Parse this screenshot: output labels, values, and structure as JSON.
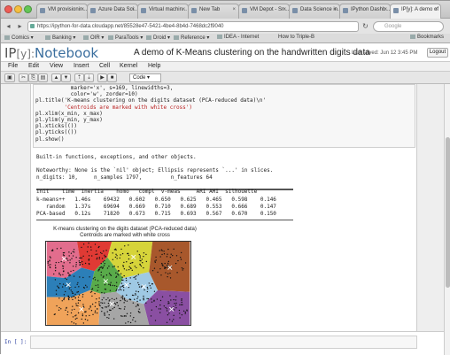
{
  "browser": {
    "tabs": [
      {
        "label": "VM provisionin...",
        "active": false
      },
      {
        "label": "Azure Data Sci...",
        "active": false
      },
      {
        "label": "Virtual machin...",
        "active": false
      },
      {
        "label": "New Tab",
        "active": false
      },
      {
        "label": "VM Depot - Sn...",
        "active": false
      },
      {
        "label": "Data Science in...",
        "active": false
      },
      {
        "label": "IPython Dashb...",
        "active": false
      },
      {
        "label": "IP[y]: A demo of K...",
        "active": true
      }
    ],
    "url": "https://ipython-for-data.cloudapp.net/85528e47-5421-4be4-8b4d-7468dc2f9040",
    "search_placeholder": "Google",
    "bookmarks": [
      "Comics",
      "Banking",
      "OIR",
      "ParaTools",
      "Droid",
      "Reference",
      "IDEA - Internet",
      "How to Triple-B",
      "Bookmarks"
    ]
  },
  "notebook": {
    "logo_ip": "IP",
    "logo_y": "[y]:",
    "logo_notebook": "Notebook",
    "title": "A demo of K-Means clustering on the handwritten digits data",
    "last_saved": "Last saved: Jun 12 3:45 PM",
    "logout_label": "Logout",
    "menu": [
      "File",
      "Edit",
      "View",
      "Insert",
      "Cell",
      "Kernel",
      "Help"
    ],
    "cell_type": "Code",
    "code_lines": [
      "           marker='x', s=169, linewidths=3,",
      "           color='w', zorder=10)",
      "pl.title('K-means clustering on the digits dataset (PCA-reduced data)\\n'",
      "         'Centroids are marked with white cross')",
      "pl.xlim(x_min, x_max)",
      "pl.ylim(y_min, y_max)",
      "pl.xticks(())",
      "pl.yticks(())",
      "pl.show()"
    ],
    "output_lines": [
      "Built-in functions, exceptions, and other objects.",
      "",
      "Noteworthy: None is the `nil' object; Ellipsis represents `...' in slices.",
      "n_digits: 10,     n_samples 1797,         n_features 64"
    ],
    "table_header": "init    time  inertia    homo   compl  v-meas     ARI AMI  silhouette",
    "table_rows": [
      "k-means++   1.46s    69432   0.602   0.650   0.625   0.465   0.598    0.146",
      "   random   1.37s    69694   0.669   0.710   0.689   0.553   0.666    0.147",
      "PCA-based   0.12s    71820   0.673   0.715   0.693   0.567   0.670    0.150"
    ],
    "figure_title_1": "K-means clustering on the digits dataset (PCA-reduced data)",
    "figure_title_2": "Centroids are marked with white cross",
    "input_prompt": "In [ ]:"
  }
}
